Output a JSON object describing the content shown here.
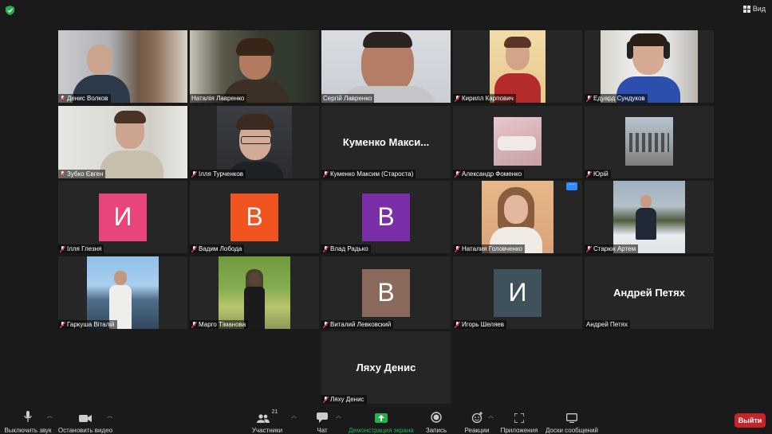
{
  "view": {
    "label": "Вид"
  },
  "tiles": {
    "t0": {
      "name": "Денис Волков"
    },
    "t1": {
      "name": "Наталія Лавренко"
    },
    "t2": {
      "name": "Сергій Лавренко"
    },
    "t3": {
      "name": "Кирилл Карпович"
    },
    "t4": {
      "name": "Едуард Сундуков"
    },
    "t5": {
      "name": "Зубко Євген"
    },
    "t6": {
      "name": "Ілля Турченков"
    },
    "t7": {
      "name": "Куменко Максим (Староста)",
      "display": "Куменко  Макси..."
    },
    "t8": {
      "name": "Александр Фоменко"
    },
    "t9": {
      "name": "Юрій"
    },
    "t10": {
      "name": "Ілля Глезня",
      "initial": "И"
    },
    "t11": {
      "name": "Вадим Лобода",
      "initial": "В"
    },
    "t12": {
      "name": "Влад Радько",
      "initial": "В"
    },
    "t13": {
      "name": "Наталия Головченко",
      "more": "···"
    },
    "t14": {
      "name": "Старюк Артем"
    },
    "t15": {
      "name": "Гаркуша Віталій"
    },
    "t16": {
      "name": "Марго Тіманова"
    },
    "t17": {
      "name": "Виталий Левковский",
      "initial": "В"
    },
    "t18": {
      "name": "Игорь Шеляев",
      "initial": "И"
    },
    "t19": {
      "name": "Андрей Петях",
      "display": "Андрей Петях"
    },
    "t20": {
      "name": "Ляху Денис",
      "display": "Ляху Денис"
    }
  },
  "toolbar": {
    "mute": "Выключить звук",
    "video": "Остановить видео",
    "participants": "Участники",
    "participants_count": "21",
    "chat": "Чат",
    "share": "Демонстрация экрана",
    "record": "Запись",
    "reactions": "Реакции",
    "apps": "Приложения",
    "whiteboards": "Доски сообщений",
    "leave": "Выйти"
  },
  "colors": {
    "active_speaker": "#b6e34a",
    "share_label": "#22b24c",
    "leave": "#c8232b",
    "avatar_pink": "#e8457a",
    "avatar_orange": "#f2541f",
    "avatar_purple": "#7a2fa8",
    "avatar_brown": "#8a6a5c",
    "avatar_slate": "#3f525c"
  }
}
